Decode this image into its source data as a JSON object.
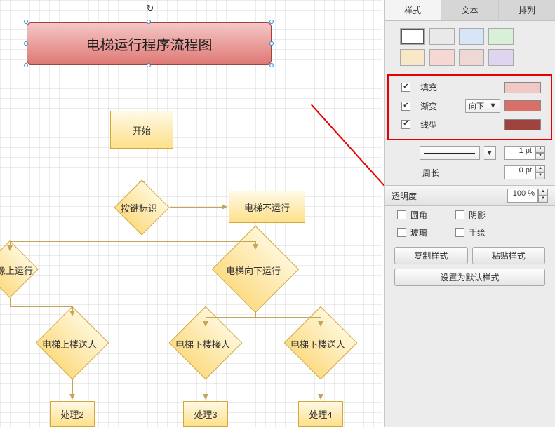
{
  "title_box": {
    "text": "电梯运行程序流程图"
  },
  "flow": {
    "start": "开始",
    "key_id": "按键标识",
    "not_run": "电梯不运行",
    "up_run": "像上运行",
    "down_run": "电梯向下运行",
    "upstairs_send": "电梯上楼送人",
    "down_pick": "电梯下楼接人",
    "down_send": "电梯下楼送人",
    "proc2": "处理2",
    "proc3": "处理3",
    "proc4": "处理4"
  },
  "panel": {
    "tabs": {
      "style": "样式",
      "text": "文本",
      "arrange": "排列"
    },
    "fill_label": "填充",
    "gradient_label": "渐变",
    "gradient_dir": "向下",
    "line_style_label": "线型",
    "fill_color": "#f0c8c6",
    "gradient_color": "#d86f69",
    "line_color": "#9e433e",
    "line_width": "1 pt",
    "perimeter_label": "周长",
    "perimeter": "0 pt",
    "opacity_label": "透明度",
    "opacity": "100 %",
    "rounded": "圆角",
    "shadow": "阴影",
    "glass": "玻璃",
    "sketch": "手绘",
    "copy_style": "复制样式",
    "paste_style": "粘贴样式",
    "set_default": "设置为默认样式"
  },
  "swatches_top": [
    "#ffffff",
    "#e9e9e9",
    "#d6e6f7",
    "#d8f0d6"
  ],
  "swatches_bot": [
    "#f9e8c8",
    "#f6d7d4",
    "#efd7d5",
    "#e0d5ef"
  ]
}
